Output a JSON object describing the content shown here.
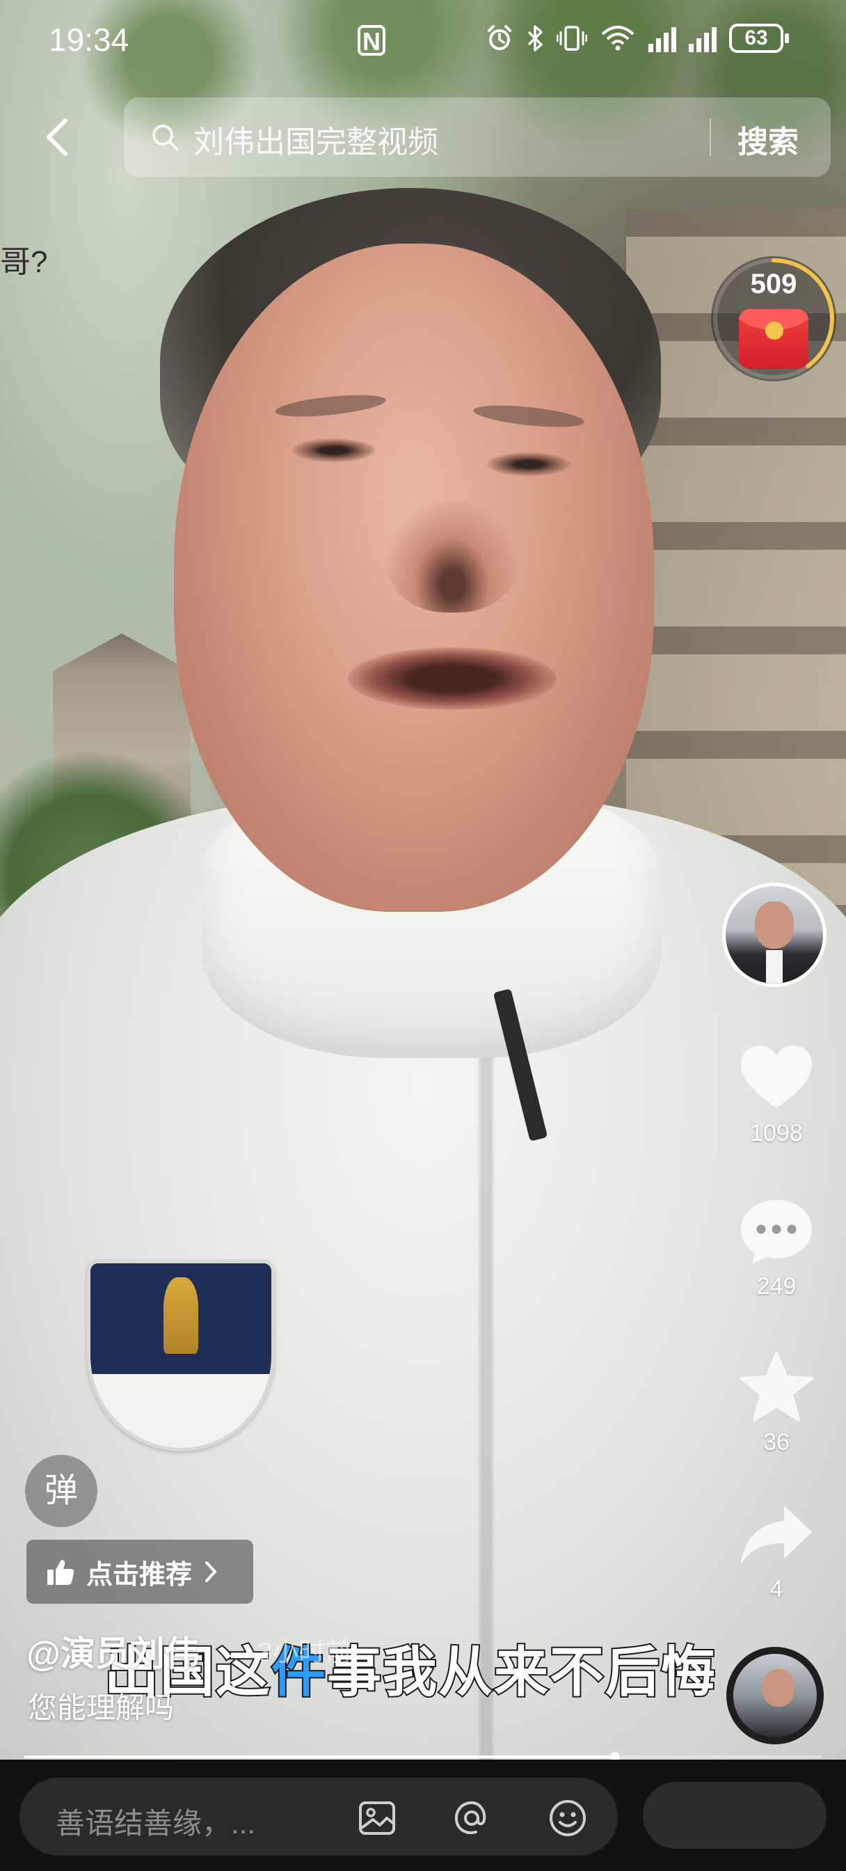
{
  "status_bar": {
    "time": "19:34",
    "nfc": "N",
    "battery": "63",
    "icons": [
      "nfc-icon",
      "alarm-icon",
      "bluetooth-icon",
      "vibrate-icon",
      "wifi-icon",
      "signal-icon",
      "signal-icon",
      "battery-icon"
    ]
  },
  "search": {
    "query": "刘伟出国完整视频",
    "button_label": "搜索"
  },
  "overlay_fragment": "哥?",
  "reward": {
    "count": "509",
    "progress": 0.4
  },
  "actions": {
    "like_count": "1098",
    "comment_count": "249",
    "favorite_count": "36",
    "share_count": "4"
  },
  "danmaku_label": "弹",
  "recommend_label": "点击推荐",
  "author": "@演员刘伟",
  "post_time": "3小时前",
  "caption": "您能理解吗",
  "subtitle": {
    "part1": "出国这",
    "highlight": "件",
    "part2": "事我从来不后悔"
  },
  "progress": 0.74,
  "comment_bar": {
    "placeholder": "善语结善缘，..."
  },
  "colors": {
    "accent": "#2d9bff",
    "bottom_bar": "#121212",
    "reward_red": "#d41e2a"
  }
}
